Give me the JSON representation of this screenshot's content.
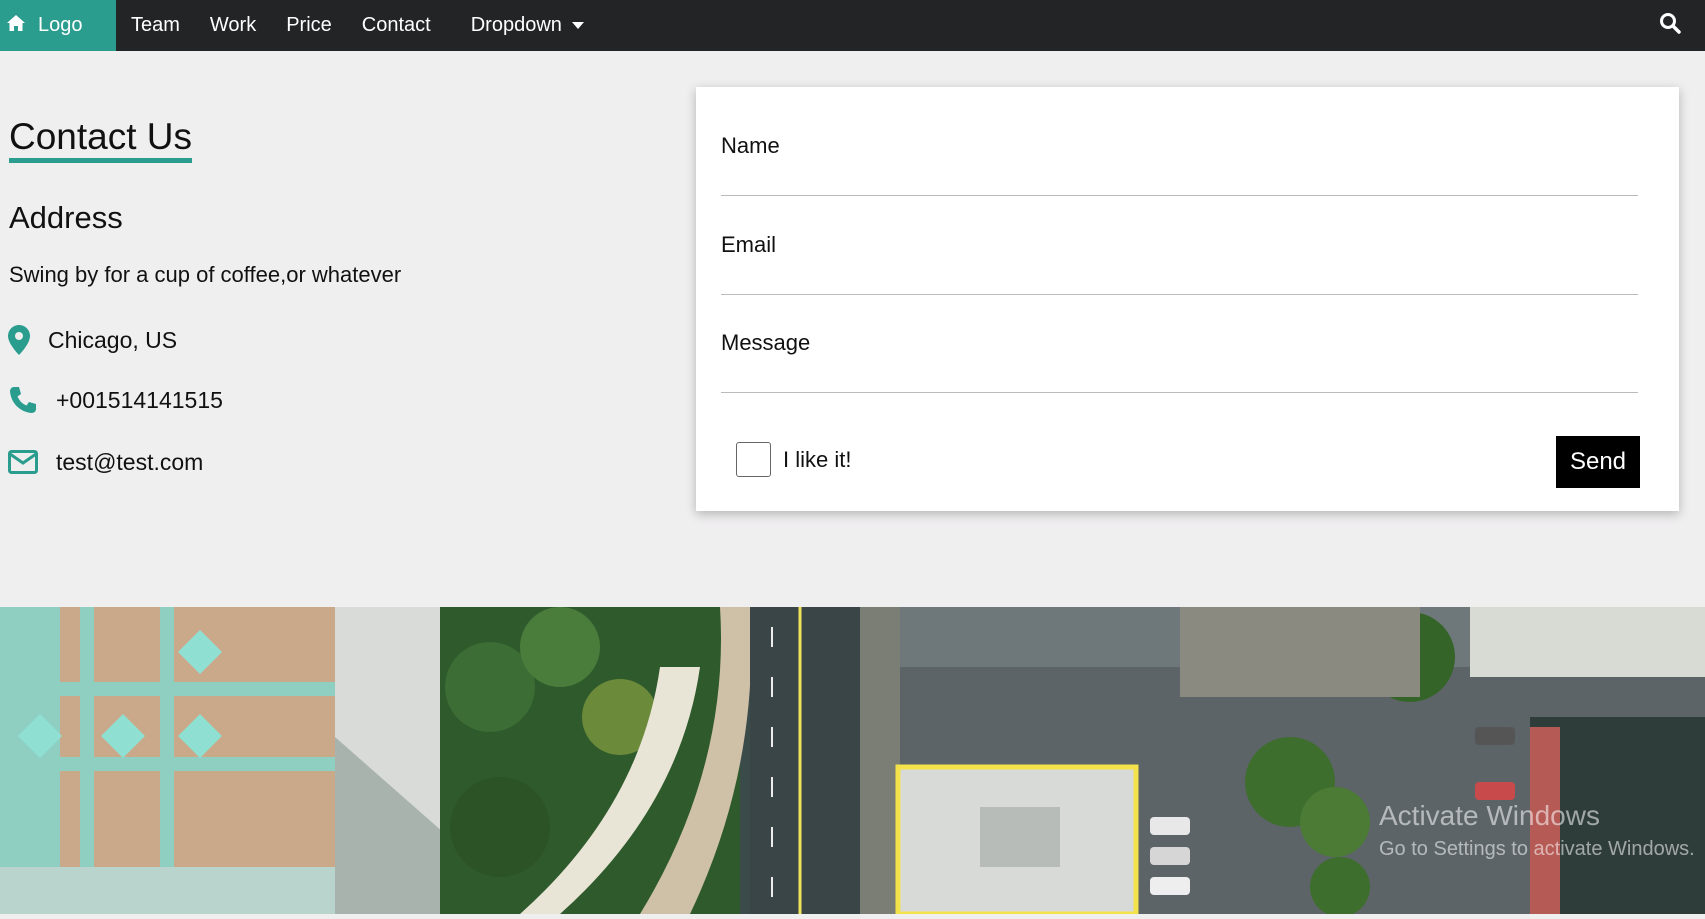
{
  "navbar": {
    "logo_label": "Logo",
    "items": [
      {
        "label": "Team"
      },
      {
        "label": "Work"
      },
      {
        "label": "Price"
      },
      {
        "label": "Contact"
      }
    ],
    "dropdown_label": "Dropdown",
    "logo_bg": "#2a9d8f",
    "bg": "#222426",
    "home_icon": "home-icon",
    "search_icon": "search-icon"
  },
  "contact": {
    "title": "Contact Us",
    "address_title": "Address",
    "address_text": "Swing by for a cup of coffee,or whatever",
    "location": "Chicago, US",
    "phone": "+001514141515",
    "email": "test@test.com",
    "accent": "#2a9d8f"
  },
  "form": {
    "name_label": "Name",
    "email_label": "Email",
    "message_label": "Message",
    "checkbox_label": "I like it!",
    "checkbox_checked": false,
    "send_label": "Send"
  },
  "watermark": {
    "line1": "Activate Windows",
    "line2": "Go to Settings to activate Windows."
  }
}
